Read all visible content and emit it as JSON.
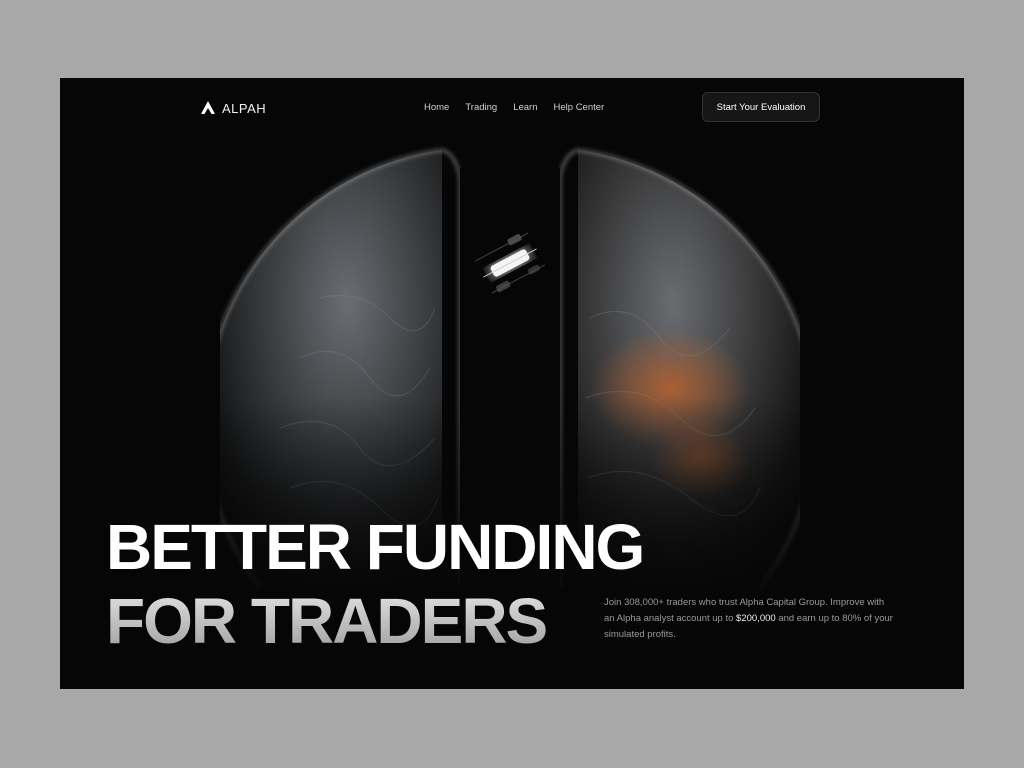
{
  "nav": {
    "brand": "ALPAH",
    "links": [
      "Home",
      "Trading",
      "Learn",
      "Help Center"
    ],
    "cta": "Start Your Evaluation"
  },
  "hero": {
    "headline_line1": "BETTER FUNDING",
    "headline_line2": "FOR TRADERS",
    "description_part1": "Join 308,000+ traders who trust Alpha Capital Group. Improve with an Alpha analyst account up to ",
    "description_highlight": "$200,000",
    "description_part2": " and earn up to 80% of your simulated profits."
  },
  "colors": {
    "background": "#060606",
    "outer_background": "#a8a8a8",
    "text_primary": "#ffffff",
    "text_muted": "#9a9a9a"
  },
  "icons": {
    "logo": "alpah-logo-icon",
    "hero_art": "split-planet-candlestick-illustration"
  }
}
